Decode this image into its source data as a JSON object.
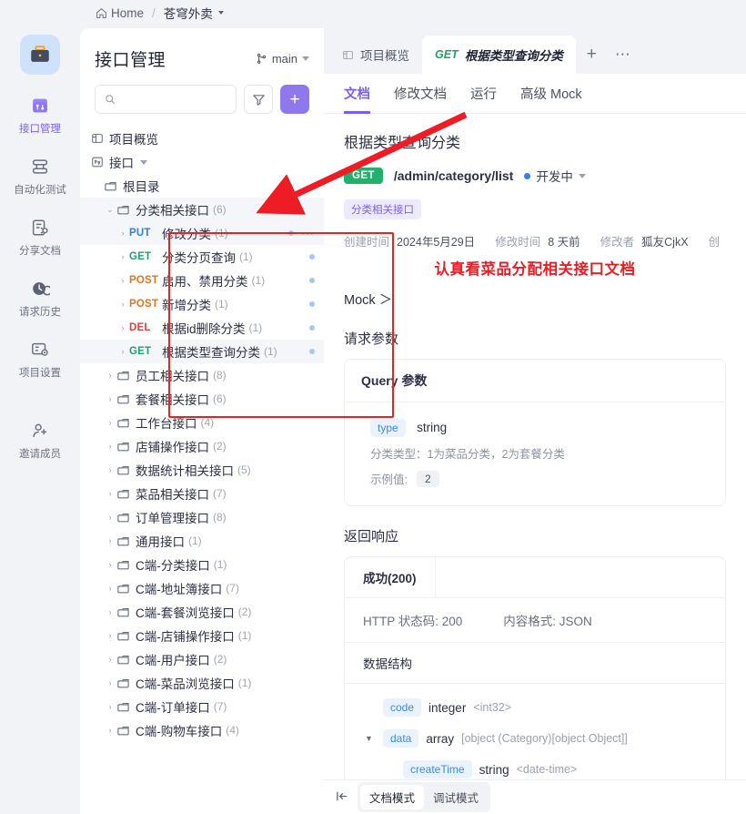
{
  "breadcrumb": {
    "home": "Home",
    "separator": "/",
    "project": "苍穹外卖"
  },
  "rail": {
    "items": [
      {
        "label": "接口管理",
        "icon": "api-manage-icon",
        "active": true
      },
      {
        "label": "自动化测试",
        "icon": "automation-test-icon",
        "active": false
      },
      {
        "label": "分享文档",
        "icon": "share-doc-icon",
        "active": false
      },
      {
        "label": "请求历史",
        "icon": "request-history-icon",
        "active": false
      },
      {
        "label": "项目设置",
        "icon": "project-settings-icon",
        "active": false
      },
      {
        "label": "邀请成员",
        "icon": "invite-member-icon",
        "active": false
      }
    ]
  },
  "panel": {
    "title": "接口管理",
    "branch": "main",
    "search_placeholder": "",
    "filter_icon": "filter-icon",
    "add_label": "+",
    "nav": [
      {
        "label": "项目概览",
        "icon": "overview-icon"
      },
      {
        "label": "接口",
        "icon": "api-icon",
        "caret": true
      }
    ],
    "root_folder": {
      "label": "根目录",
      "icon": "folder-icon"
    },
    "group": {
      "label": "分类相关接口",
      "count": "(6)",
      "expanded": true
    },
    "apis": [
      {
        "method": "PUT",
        "name": "修改分类",
        "count": "(1)",
        "hovered": true,
        "more": "⋯"
      },
      {
        "method": "GET",
        "name": "分类分页查询",
        "count": "(1)",
        "hovered": false,
        "more": ""
      },
      {
        "method": "POST",
        "name": "启用、禁用分类",
        "count": "(1)",
        "hovered": false,
        "more": ""
      },
      {
        "method": "POST",
        "name": "新增分类",
        "count": "(1)",
        "hovered": false,
        "more": ""
      },
      {
        "method": "DEL",
        "name": "根据id删除分类",
        "count": "(1)",
        "hovered": false,
        "more": ""
      },
      {
        "method": "GET",
        "name": "根据类型查询分类",
        "count": "(1)",
        "hovered": true,
        "more": ""
      }
    ],
    "folders": [
      {
        "label": "员工相关接口",
        "count": "(8)"
      },
      {
        "label": "套餐相关接口",
        "count": "(6)"
      },
      {
        "label": "工作台接口",
        "count": "(4)"
      },
      {
        "label": "店铺操作接口",
        "count": "(2)"
      },
      {
        "label": "数据统计相关接口",
        "count": "(5)"
      },
      {
        "label": "菜品相关接口",
        "count": "(7)"
      },
      {
        "label": "订单管理接口",
        "count": "(8)"
      },
      {
        "label": "通用接口",
        "count": "(1)"
      },
      {
        "label": "C端-分类接口",
        "count": "(1)"
      },
      {
        "label": "C端-地址簿接口",
        "count": "(7)"
      },
      {
        "label": "C端-套餐浏览接口",
        "count": "(2)"
      },
      {
        "label": "C端-店铺操作接口",
        "count": "(1)"
      },
      {
        "label": "C端-用户接口",
        "count": "(2)"
      },
      {
        "label": "C端-菜品浏览接口",
        "count": "(1)"
      },
      {
        "label": "C端-订单接口",
        "count": "(7)"
      },
      {
        "label": "C端-购物车接口",
        "count": "(4)"
      }
    ]
  },
  "main": {
    "tabs": [
      {
        "label": "项目概览",
        "method": "",
        "active": false
      },
      {
        "label": "根据类型查询分类",
        "method": "GET",
        "active": true
      }
    ],
    "tab_add": "+",
    "tab_more": "⋯",
    "subtabs": [
      {
        "label": "文档",
        "active": true
      },
      {
        "label": "修改文档",
        "active": false
      },
      {
        "label": "运行",
        "active": false
      },
      {
        "label": "高级 Mock",
        "active": false
      }
    ],
    "doc": {
      "title": "根据类型查询分类",
      "method": "GET",
      "url": "/admin/category/list",
      "status": "开发中",
      "tag": "分类相关接口",
      "meta": [
        {
          "key": "创建时间",
          "value": "2024年5月29日"
        },
        {
          "key": "修改时间",
          "value": "8 天前"
        },
        {
          "key": "修改者",
          "value": "狐友CjkX"
        },
        {
          "key": "创",
          "value": ""
        }
      ],
      "annotation": "认真看菜品分配相关接口文档",
      "mock_link": "Mock ＞",
      "request_params_title": "请求参数",
      "query_card_title": "Query 参数",
      "query_param": {
        "name": "type",
        "type": "string",
        "desc": "分类类型：1为菜品分类，2为套餐分类",
        "example_label": "示例值:",
        "example_value": "2"
      },
      "response_title": "返回响应",
      "response_tab": "成功(200)",
      "http_status_label": "HTTP 状态码: 200",
      "content_type_label": "内容格式: JSON",
      "struct_title": "数据结构",
      "fields": [
        {
          "name": "code",
          "type": "integer",
          "meta": "<int32>",
          "indent": 0,
          "tri": ""
        },
        {
          "name": "data",
          "type": "array",
          "meta": "[object (Category)[object Object]]",
          "indent": 0,
          "tri": "▼"
        },
        {
          "name": "createTime",
          "type": "string",
          "meta": "<date-time>",
          "indent": 1,
          "tri": ""
        }
      ]
    }
  },
  "bottom": {
    "collapse_icon": "collapse-left-icon",
    "modes": [
      {
        "label": "文档模式",
        "active": true
      },
      {
        "label": "调试模式",
        "active": false
      }
    ]
  },
  "colors": {
    "accent_purple": "#8f77ed",
    "get_green": "#22a06b",
    "post_orange": "#e8711a",
    "put_blue": "#2a7fe8",
    "del_red": "#e03e3e",
    "annotation_red": "#ec1c24",
    "page_bg": "#f2f3f7"
  }
}
